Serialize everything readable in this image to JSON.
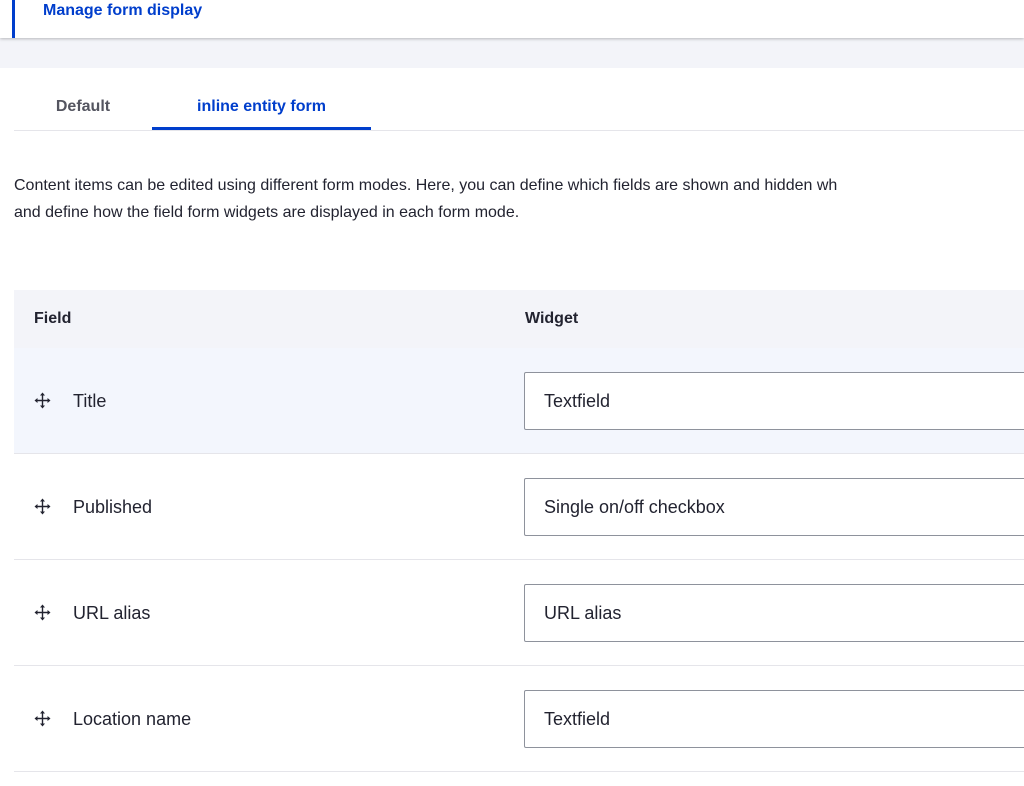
{
  "primary_tab": {
    "label": "Manage form display"
  },
  "secondary_tabs": [
    {
      "label": "Default",
      "active": false
    },
    {
      "label": "inline entity form",
      "active": true
    }
  ],
  "description": {
    "line1": "Content items can be edited using different form modes. Here, you can define which fields are shown and hidden wh",
    "line2": "and define how the field form widgets are displayed in each form mode."
  },
  "table": {
    "headers": {
      "field": "Field",
      "widget": "Widget"
    },
    "rows": [
      {
        "field": "Title",
        "widget": "Textfield",
        "highlighted": true,
        "icon": "drag-handle-icon"
      },
      {
        "field": "Published",
        "widget": "Single on/off checkbox",
        "highlighted": false,
        "icon": "drag-handle-icon"
      },
      {
        "field": "URL alias",
        "widget": "URL alias",
        "highlighted": false,
        "icon": "drag-handle-icon"
      },
      {
        "field": "Location name",
        "widget": "Textfield",
        "highlighted": false,
        "icon": "drag-handle-icon"
      }
    ]
  },
  "colors": {
    "accent": "#003ecc",
    "header_bg": "#f3f4f9",
    "highlight_row": "#f3f6fd",
    "border": "#e5e5ea"
  }
}
